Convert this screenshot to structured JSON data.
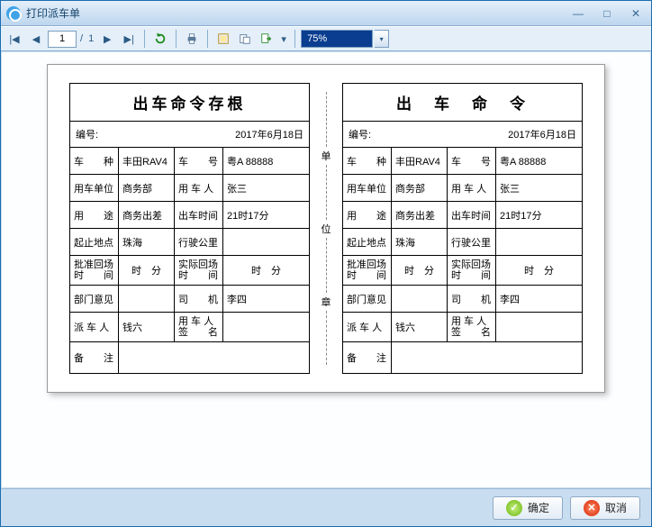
{
  "window": {
    "title": "打印派车单"
  },
  "toolbar": {
    "page_current": "1",
    "page_sep": "/",
    "page_total": "1",
    "zoom": "75%"
  },
  "forms": {
    "stub": {
      "title": "出车命令存根",
      "header_num_label": "编号:",
      "header_date": "2017年6月18日",
      "rows": {
        "vehicle_type_lbl": "车　　种",
        "vehicle_type_val": "丰田RAV4",
        "vehicle_no_lbl": "车　　号",
        "vehicle_no_val": "粤A 88888",
        "dept_lbl": "用车单位",
        "dept_val": "商务部",
        "user_lbl": "用 车 人",
        "user_val": "张三",
        "purpose_lbl": "用　　途",
        "purpose_val": "商务出差",
        "depart_lbl": "出车时间",
        "depart_val": "21时17分",
        "loc_lbl": "起止地点",
        "loc_val": "珠海",
        "km_lbl": "行驶公里",
        "km_val": "",
        "approve_lbl": "批准回场时　　间",
        "approve_val": "时　分",
        "actual_lbl": "实际回场时　　间",
        "actual_val": "时　分",
        "opinion_lbl": "部门意见",
        "opinion_val": "",
        "driver_lbl": "司　　机",
        "driver_val": "李四",
        "dispatcher_lbl": "派 车 人",
        "dispatcher_val": "钱六",
        "sign_lbl": "用 车 人签　　名",
        "sign_val": "",
        "remark_lbl": "备　　注",
        "remark_val": ""
      }
    },
    "order": {
      "title": "出　车　命　令",
      "header_num_label": "编号:",
      "header_date": "2017年6月18日",
      "rows": {
        "vehicle_type_lbl": "车　　种",
        "vehicle_type_val": "丰田RAV4",
        "vehicle_no_lbl": "车　　号",
        "vehicle_no_val": "粤A 88888",
        "dept_lbl": "用车单位",
        "dept_val": "商务部",
        "user_lbl": "用 车 人",
        "user_val": "张三",
        "purpose_lbl": "用　　途",
        "purpose_val": "商务出差",
        "depart_lbl": "出车时间",
        "depart_val": "21时17分",
        "loc_lbl": "起止地点",
        "loc_val": "珠海",
        "km_lbl": "行驶公里",
        "km_val": "",
        "approve_lbl": "批准回场时　　间",
        "approve_val": "时　分",
        "actual_lbl": "实际回场时　　间",
        "actual_val": "时　分",
        "opinion_lbl": "部门意见",
        "opinion_val": "",
        "driver_lbl": "司　　机",
        "driver_val": "李四",
        "dispatcher_lbl": "派 车 人",
        "dispatcher_val": "钱六",
        "sign_lbl": "用 车 人签　　名",
        "sign_val": "",
        "remark_lbl": "备　　注",
        "remark_val": ""
      }
    },
    "divider_chars": [
      "单",
      "位",
      "章"
    ]
  },
  "footer": {
    "ok": "确定",
    "cancel": "取消"
  }
}
